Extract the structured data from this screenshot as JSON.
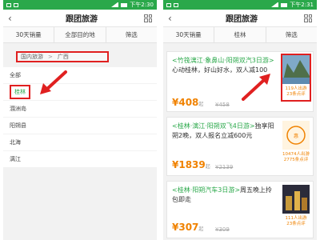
{
  "left_phone": {
    "status": {
      "time": "下午2:30"
    },
    "title": "跟团旅游",
    "filters": [
      "30天销量",
      "全部目的地",
      "筛选"
    ],
    "breadcrumb": [
      "国内旅游",
      "广西"
    ],
    "cities": [
      "全部",
      "桂林",
      "涠洲岛",
      "阳朔县",
      "北海",
      "漓江"
    ],
    "selected_city": "桂林"
  },
  "right_phone": {
    "status": {
      "time": "下午2:31"
    },
    "title": "跟团旅游",
    "filters": [
      "30天销量",
      "桂林",
      "筛选"
    ],
    "cards": [
      {
        "title_hl": "<竹筏漓江·象鼻山·阳朔双汽3日游>",
        "title": "心动桂林，好山好水，双人减100",
        "price": "¥408",
        "price_suffix": "起",
        "old_price": "¥458",
        "badge": "",
        "stats": [
          "119人出游",
          "23条点评"
        ]
      },
      {
        "title_hl": "<桂林·漓江·阳朔双飞4日游>",
        "title": "独享阳朔2晚，双人报名立减600元",
        "price": "¥1839",
        "price_suffix": "起",
        "old_price": "¥2139",
        "badge": "",
        "stats": [
          "10474人出游",
          "2775条点评"
        ]
      },
      {
        "title_hl": "<桂林·阳朔汽车3日游>",
        "title": "周五晚上拎包即走",
        "price": "¥307",
        "price_suffix": "起",
        "old_price": "¥309",
        "badge": "",
        "stats": [
          "111人出游",
          "23条点评"
        ]
      }
    ]
  },
  "colors": {
    "status_green": "#2aa84a",
    "accent_orange": "#f08200",
    "highlight_red": "#e02020"
  }
}
